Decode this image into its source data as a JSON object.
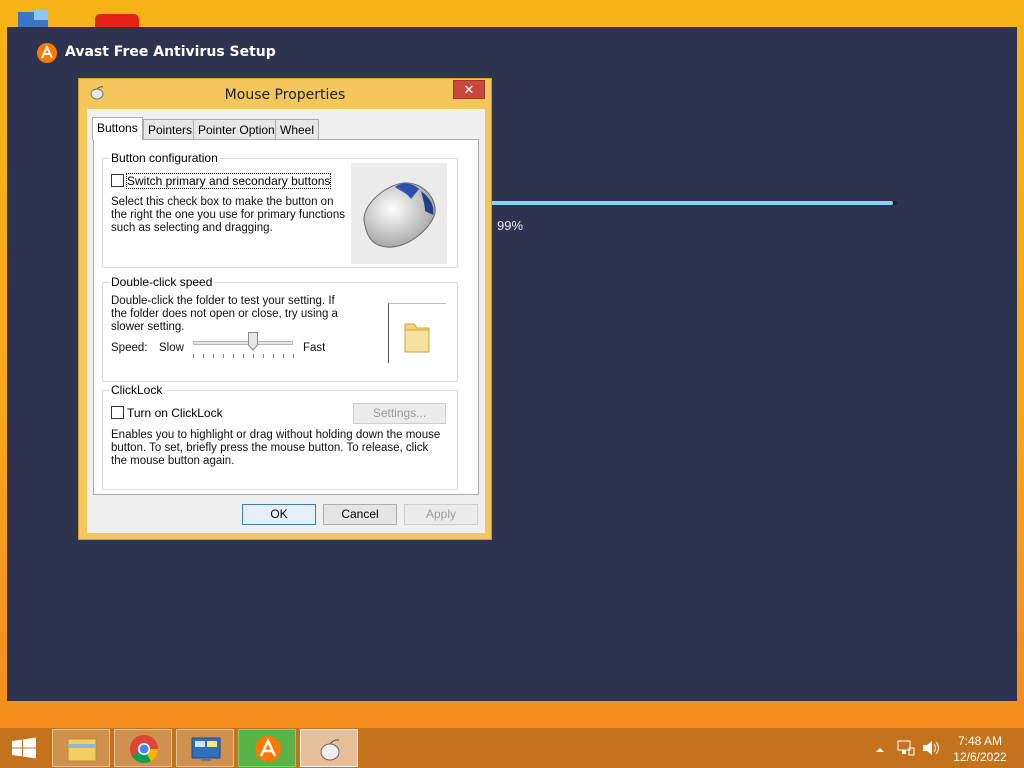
{
  "avast": {
    "title": "Avast Free Antivirus Setup",
    "progress_fraction": 0.99,
    "progress_text": "99%",
    "accent": "#7ed8f6",
    "logo_color": "#ff7800"
  },
  "dialog": {
    "title": "Mouse Properties",
    "close_glyph": "✕",
    "tabs": [
      {
        "label": "Buttons",
        "active": true
      },
      {
        "label": "Pointers",
        "active": false
      },
      {
        "label": "Pointer Options",
        "active": false
      },
      {
        "label": "Wheel",
        "active": false
      }
    ],
    "button_config": {
      "title": "Button configuration",
      "checkbox_label": "Switch primary and secondary buttons",
      "checked": false,
      "description": "Select this check box to make the button on the right the one you use for primary functions such as selecting and dragging."
    },
    "double_click": {
      "title": "Double-click speed",
      "description": "Double-click the folder to test your setting. If the folder does not open or close, try using a slower setting.",
      "speed_label": "Speed:",
      "slow_label": "Slow",
      "fast_label": "Fast",
      "speed_fraction": 0.6
    },
    "clicklock": {
      "title": "ClickLock",
      "checkbox_label": "Turn on ClickLock",
      "checked": false,
      "settings_button": "Settings...",
      "description": "Enables you to highlight or drag without holding down the mouse button. To set, briefly press the mouse button. To release, click the mouse button again."
    },
    "buttons": {
      "ok": "OK",
      "cancel": "Cancel",
      "apply": "Apply"
    }
  },
  "taskbar": {
    "clock_time": "7:48 AM",
    "clock_date": "12/6/2022",
    "apps": [
      "file-explorer-icon",
      "chrome-icon",
      "control-panel-icon",
      "avast-icon",
      "mouse-icon"
    ]
  }
}
